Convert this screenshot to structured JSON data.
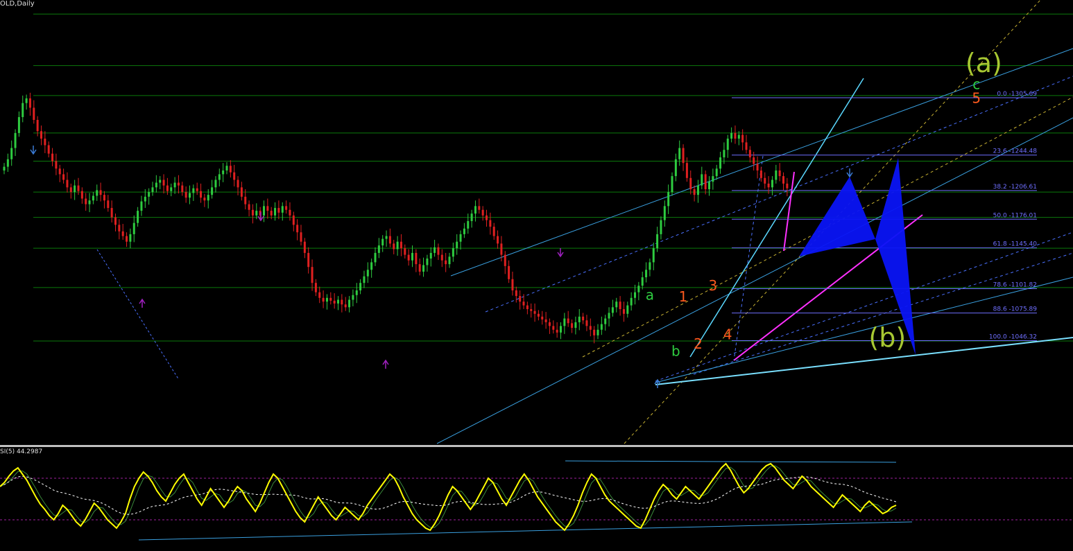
{
  "header": {
    "symbol": "OLD,Daily"
  },
  "rsi_label": "SI(5) 44.2987",
  "colors": {
    "bull": "#2ecc40",
    "bear": "#e02020",
    "grid": "#0b7a0b",
    "fib": "#6f6fff",
    "cyan": "#5ad8ff",
    "magenta": "#ff30ff",
    "blue_fill": "#0a14f5",
    "rsi": "#ffff00"
  },
  "chart_data": {
    "type": "candlestick",
    "title": "",
    "price_range": [
      935,
      1410
    ],
    "close_series": [
      1232,
      1240,
      1252,
      1268,
      1285,
      1300,
      1305,
      1295,
      1282,
      1270,
      1262,
      1255,
      1246,
      1238,
      1230,
      1224,
      1218,
      1210,
      1205,
      1212,
      1206,
      1198,
      1192,
      1196,
      1201,
      1207,
      1202,
      1196,
      1188,
      1178,
      1170,
      1163,
      1158,
      1152,
      1160,
      1172,
      1185,
      1195,
      1200,
      1205,
      1210,
      1215,
      1218,
      1212,
      1206,
      1210,
      1215,
      1212,
      1205,
      1199,
      1204,
      1209,
      1206,
      1199,
      1196,
      1202,
      1210,
      1218,
      1224,
      1228,
      1233,
      1226,
      1218,
      1210,
      1200,
      1192,
      1186,
      1180,
      1185,
      1180,
      1190,
      1185,
      1180,
      1188,
      1183,
      1190,
      1186,
      1180,
      1170,
      1162,
      1152,
      1140,
      1125,
      1108,
      1098,
      1092,
      1088,
      1092,
      1089,
      1086,
      1090,
      1085,
      1082,
      1090,
      1095,
      1100,
      1108,
      1115,
      1122,
      1130,
      1140,
      1148,
      1155,
      1158,
      1150,
      1144,
      1152,
      1145,
      1138,
      1132,
      1140,
      1128,
      1120,
      1127,
      1134,
      1140,
      1146,
      1138,
      1132,
      1128,
      1136,
      1145,
      1152,
      1160,
      1166,
      1174,
      1182,
      1190,
      1186,
      1180,
      1175,
      1168,
      1158,
      1150,
      1138,
      1126,
      1112,
      1100,
      1094,
      1088,
      1084,
      1080,
      1078,
      1075,
      1072,
      1069,
      1066,
      1062,
      1058,
      1055,
      1062,
      1070,
      1065,
      1060,
      1066,
      1072,
      1068,
      1062,
      1058,
      1052,
      1058,
      1064,
      1070,
      1076,
      1082,
      1088,
      1080,
      1075,
      1084,
      1092,
      1098,
      1105,
      1114,
      1122,
      1130,
      1145,
      1160,
      1175,
      1190,
      1205,
      1222,
      1240,
      1252,
      1236,
      1220,
      1208,
      1202,
      1212,
      1224,
      1208,
      1216,
      1222,
      1230,
      1242,
      1250,
      1262,
      1268,
      1262,
      1266,
      1258,
      1250,
      1242,
      1235,
      1228,
      1220,
      1214,
      1210,
      1218,
      1228,
      1222,
      1214,
      1209
    ],
    "fib_levels": [
      {
        "label": "0.0",
        "value": 1305.69
      },
      {
        "label": "23.6",
        "value": 1244.48
      },
      {
        "label": "38.2",
        "value": 1206.61
      },
      {
        "label": "50.0",
        "value": 1176.01
      },
      {
        "label": "61.8",
        "value": 1145.4
      },
      {
        "label": "78.6",
        "value": 1101.82
      },
      {
        "label": "88.6",
        "value": 1075.89
      },
      {
        "label": "100.0",
        "value": 1046.32
      }
    ],
    "wave_labels": [
      {
        "text": "(a)",
        "color": "#a8c832",
        "bar": 264,
        "price": 1333
      },
      {
        "text": "c",
        "color": "#2ecc40",
        "bar": 262,
        "price": 1315
      },
      {
        "text": "5",
        "color": "#ff5a1e",
        "bar": 262,
        "price": 1300
      },
      {
        "text": "a",
        "color": "#2ecc40",
        "bar": 174,
        "price": 1090
      },
      {
        "text": "b",
        "color": "#2ecc40",
        "bar": 181,
        "price": 1030
      },
      {
        "text": "1",
        "color": "#ff5a1e",
        "bar": 183,
        "price": 1088
      },
      {
        "text": "2",
        "color": "#ff5a1e",
        "bar": 187,
        "price": 1038
      },
      {
        "text": "3",
        "color": "#ff5a1e",
        "bar": 191,
        "price": 1100
      },
      {
        "text": "4",
        "color": "#ff5a1e",
        "bar": 195,
        "price": 1048
      },
      {
        "text": "(b)",
        "color": "#a8c832",
        "bar": 238,
        "price": 1040
      }
    ],
    "rsi": {
      "name": "RSI(5)",
      "value": 44.2987,
      "range": [
        0,
        100
      ],
      "levels": [
        70,
        30
      ],
      "values": [
        62,
        66,
        72,
        77,
        80,
        74,
        68,
        60,
        52,
        45,
        40,
        34,
        30,
        36,
        44,
        40,
        34,
        28,
        24,
        30,
        38,
        46,
        42,
        36,
        30,
        26,
        22,
        28,
        36,
        50,
        62,
        70,
        76,
        72,
        66,
        58,
        52,
        48,
        56,
        64,
        70,
        74,
        66,
        58,
        50,
        44,
        52,
        60,
        54,
        48,
        42,
        48,
        56,
        62,
        58,
        50,
        44,
        38,
        46,
        56,
        66,
        74,
        70,
        62,
        54,
        46,
        38,
        32,
        28,
        36,
        44,
        52,
        46,
        40,
        34,
        30,
        36,
        42,
        38,
        34,
        30,
        36,
        44,
        50,
        56,
        62,
        68,
        74,
        70,
        62,
        52,
        44,
        36,
        30,
        26,
        22,
        20,
        26,
        34,
        44,
        54,
        62,
        58,
        52,
        46,
        40,
        46,
        54,
        62,
        70,
        66,
        58,
        50,
        44,
        52,
        60,
        68,
        74,
        68,
        60,
        52,
        46,
        40,
        34,
        28,
        24,
        20,
        26,
        34,
        44,
        56,
        66,
        74,
        70,
        62,
        54,
        48,
        44,
        40,
        36,
        32,
        28,
        24,
        22,
        30,
        40,
        50,
        58,
        64,
        60,
        54,
        50,
        56,
        62,
        58,
        54,
        50,
        56,
        62,
        68,
        74,
        80,
        84,
        78,
        70,
        62,
        56,
        60,
        66,
        72,
        78,
        82,
        84,
        80,
        74,
        68,
        64,
        60,
        66,
        72,
        68,
        62,
        58,
        54,
        50,
        46,
        42,
        48,
        54,
        50,
        46,
        42,
        38,
        44,
        48,
        44,
        40,
        36,
        38,
        42,
        44
      ]
    }
  }
}
